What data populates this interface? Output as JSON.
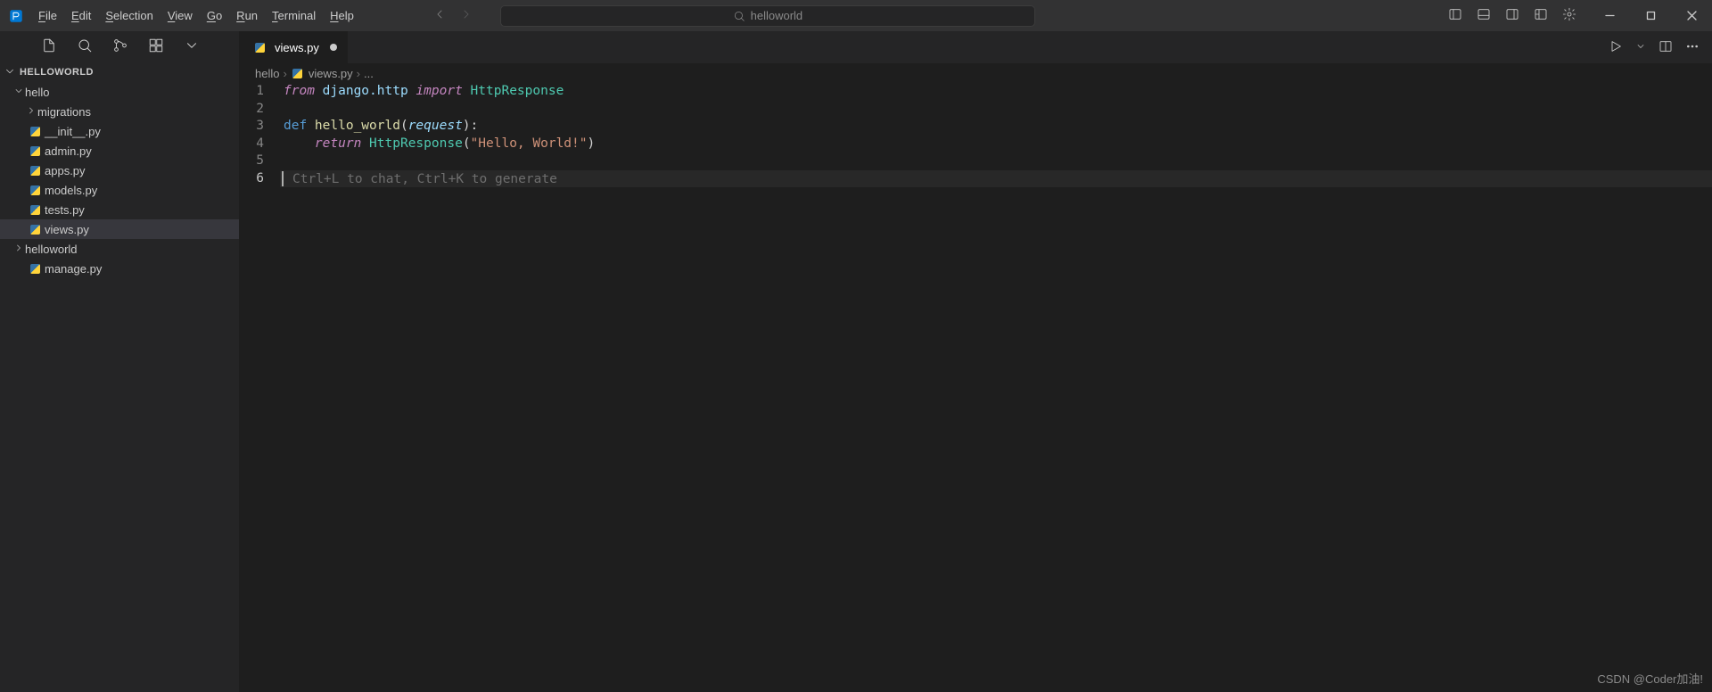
{
  "menubar": {
    "file": "File",
    "edit": "Edit",
    "selection": "Selection",
    "view": "View",
    "go": "Go",
    "run": "Run",
    "terminal": "Terminal",
    "help": "Help"
  },
  "search_text": "helloworld",
  "sidebar": {
    "section": "HELLOWORLD",
    "tree": {
      "hello_folder": "hello",
      "migrations": "migrations",
      "init": "__init__.py",
      "admin": "admin.py",
      "apps": "apps.py",
      "models": "models.py",
      "tests": "tests.py",
      "views": "views.py",
      "helloworld_folder": "helloworld",
      "manage": "manage.py"
    }
  },
  "tab": {
    "label": "views.py"
  },
  "breadcrumbs": {
    "p1": "hello",
    "p2": "views.py",
    "p3": "..."
  },
  "line_numbers": [
    "1",
    "2",
    "3",
    "4",
    "5",
    "6"
  ],
  "code": {
    "l1": {
      "from": "from",
      "mod": " django.http ",
      "import": "import",
      "cls": " HttpResponse"
    },
    "l3": {
      "def": "def ",
      "fn": "hello_world",
      "lpar": "(",
      "param": "request",
      "rpar": "):"
    },
    "l4": {
      "ind": "    ",
      "ret": "return",
      "sp": " ",
      "cls": "HttpResponse",
      "lpar": "(",
      "str": "\"Hello, World!\"",
      "rpar": ")"
    },
    "placeholder": "Ctrl+L to chat, Ctrl+K to generate"
  },
  "watermark": "CSDN @Coder加油!"
}
